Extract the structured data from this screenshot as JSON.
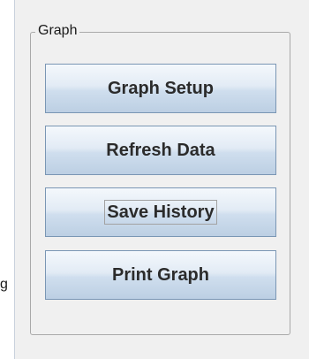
{
  "left_panel": {
    "clipped_label": "g"
  },
  "graph_group": {
    "title": "Graph",
    "buttons": {
      "graph_setup": "Graph Setup",
      "refresh_data": "Refresh Data",
      "save_history": "Save History",
      "print_graph": "Print Graph"
    }
  }
}
